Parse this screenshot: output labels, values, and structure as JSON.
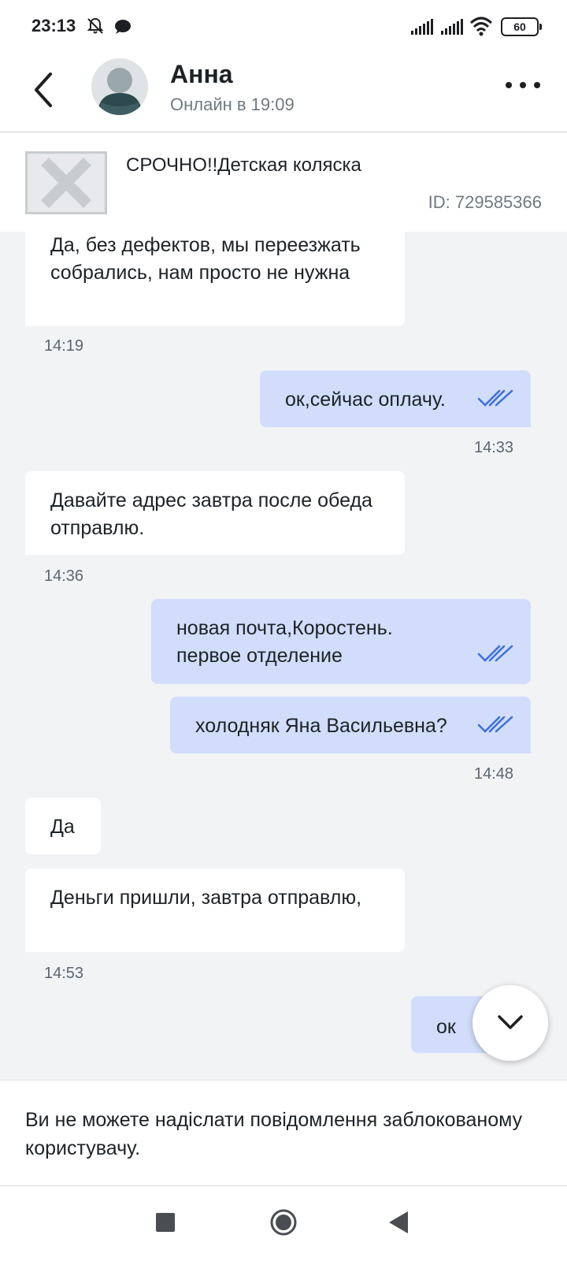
{
  "status_bar": {
    "time": "23:13",
    "battery": "60"
  },
  "header": {
    "contact_name": "Анна",
    "contact_status": "Онлайн в 19:09"
  },
  "ad": {
    "title": "СРОЧНО!!Детская коляска",
    "id": "ID: 729585366"
  },
  "messages": [
    {
      "direction": "in",
      "text": "Да, без дефектов, мы переезжать собрались, нам просто не нужна",
      "time": "14:19"
    },
    {
      "direction": "out",
      "text": "ок,сейчас оплачу.",
      "time": "14:33",
      "read": true
    },
    {
      "direction": "in",
      "text": "Давайте адрес завтра после обеда отправлю.",
      "time": "14:36"
    },
    {
      "direction": "out",
      "text": "новая почта,Коростень. первое отделение",
      "read": true
    },
    {
      "direction": "out",
      "text": "холодняк Яна Васильевна?",
      "time": "14:48",
      "read": true
    },
    {
      "direction": "in",
      "text": "Да"
    },
    {
      "direction": "in",
      "text": "Деньги пришли, завтра отправлю,",
      "time": "14:53"
    },
    {
      "direction": "out",
      "text": "ок"
    }
  ],
  "blocked_notice": "Ви не можете надіслати повідомлення заблокованому користувачу.",
  "colors": {
    "outgoing_bubble": "#d1ddfb",
    "incoming_bubble": "#ffffff",
    "chat_background": "#f2f3f5",
    "read_ticks": "#3d6fd6"
  },
  "icons": [
    "back-arrow-icon",
    "muted-bell-icon",
    "chat-bubble-icon",
    "signal-icon",
    "wifi-icon",
    "battery-icon",
    "more-dots-icon",
    "image-placeholder-icon",
    "double-check-icon",
    "chevron-down-icon",
    "nav-recents-icon",
    "nav-home-icon",
    "nav-back-icon"
  ]
}
